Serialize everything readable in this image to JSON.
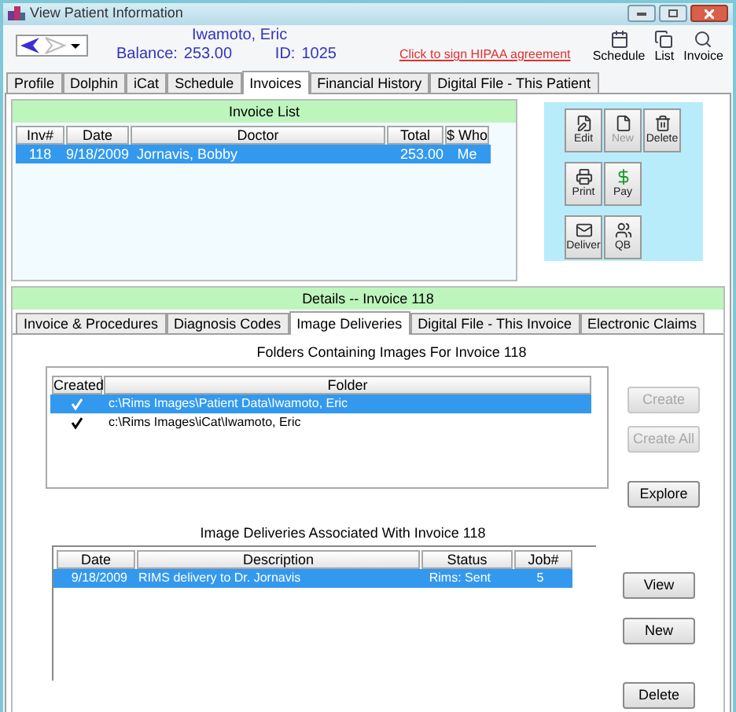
{
  "window": {
    "title": "View Patient Information"
  },
  "patient": {
    "name": "Iwamoto, Eric",
    "balance_label": "Balance:",
    "balance": "253.00",
    "id_label": "ID:",
    "id": "1025",
    "hipaa_link": "Click to sign HIPAA agreement"
  },
  "header_tools": [
    {
      "label": "Schedule",
      "kind": "calendar"
    },
    {
      "label": "List",
      "kind": "pages"
    },
    {
      "label": "Invoice",
      "kind": "search"
    }
  ],
  "tabs": [
    {
      "label": "Profile",
      "selected": false
    },
    {
      "label": "Dolphin",
      "selected": false
    },
    {
      "label": "iCat",
      "selected": false
    },
    {
      "label": "Schedule",
      "selected": false
    },
    {
      "label": "Invoices",
      "selected": true
    },
    {
      "label": "Financial History",
      "selected": false
    },
    {
      "label": "Digital File - This Patient",
      "selected": false
    }
  ],
  "invoice_list": {
    "title": "Invoice List",
    "columns": [
      "Inv#",
      "Date",
      "Doctor",
      "Total",
      "$ Who"
    ],
    "rows": [
      {
        "cells": [
          "118",
          "9/18/2009",
          "Jornavis, Bobby",
          "253.00",
          "Me"
        ],
        "selected": true
      }
    ]
  },
  "invoice_actions": [
    [
      {
        "label": "Edit",
        "kind": "edit",
        "disabled": false
      },
      {
        "label": "New",
        "kind": "new",
        "disabled": true
      },
      {
        "label": "Delete",
        "kind": "delete",
        "disabled": false
      }
    ],
    [
      {
        "label": "Print",
        "kind": "print",
        "disabled": false
      },
      {
        "label": "Pay",
        "kind": "pay",
        "disabled": false
      }
    ],
    [
      {
        "label": "Deliver",
        "kind": "deliver",
        "disabled": false
      },
      {
        "label": "QB",
        "kind": "qb",
        "disabled": false
      }
    ]
  ],
  "details": {
    "title": "Details -- Invoice 118",
    "tabs": [
      {
        "label": "Invoice & Procedures",
        "selected": false
      },
      {
        "label": "Diagnosis Codes",
        "selected": false
      },
      {
        "label": "Image Deliveries",
        "selected": true
      },
      {
        "label": "Digital File - This Invoice",
        "selected": false
      },
      {
        "label": "Electronic Claims",
        "selected": false
      }
    ],
    "folders": {
      "caption": "Folders Containing Images For Invoice 118",
      "columns": [
        "Created",
        "Folder"
      ],
      "rows": [
        {
          "created": true,
          "folder": "c:\\Rims Images\\Patient Data\\Iwamoto, Eric",
          "selected": true
        },
        {
          "created": true,
          "folder": "c:\\Rims Images\\iCat\\Iwamoto, Eric",
          "selected": false
        }
      ],
      "buttons": [
        {
          "label": "Create",
          "disabled": true
        },
        {
          "label": "Create All",
          "disabled": true
        },
        {
          "label": "Explore",
          "disabled": false
        }
      ]
    },
    "deliveries": {
      "caption": "Image Deliveries Associated With Invoice 118",
      "columns": [
        "Date",
        "Description",
        "Status",
        "Job#"
      ],
      "rows": [
        {
          "cells": [
            "9/18/2009",
            "RIMS delivery to Dr. Jornavis",
            "Rims: Sent",
            "5"
          ],
          "selected": true
        }
      ],
      "buttons": [
        {
          "label": "View",
          "disabled": false
        },
        {
          "label": "New",
          "disabled": false
        },
        {
          "label": "Delete",
          "disabled": false
        }
      ]
    }
  }
}
